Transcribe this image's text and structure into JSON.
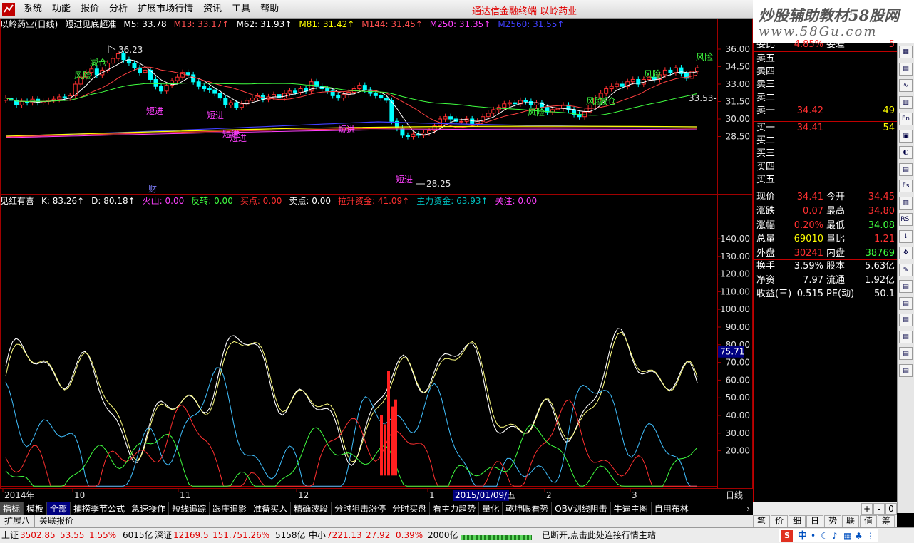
{
  "menu": {
    "items": [
      "系统",
      "功能",
      "报价",
      "分析",
      "扩展市场行情",
      "资讯",
      "工具",
      "帮助"
    ],
    "center_title": "通达信金融终端   以岭药业",
    "watermark_line1": "炒股辅助教材58股网",
    "watermark_line2": "www.58Gu.com"
  },
  "main_title": {
    "stock": "以岭药业(日线)",
    "indicator": "短进见底超准",
    "ma": [
      {
        "label": "M5: 33.78",
        "color": "#ffffff"
      },
      {
        "label": "M13: 33.17↑",
        "color": "#ff5050"
      },
      {
        "label": "M62: 31.93↑",
        "color": "#ffffff"
      },
      {
        "label": "M81: 31.42↑",
        "color": "#ffff00"
      },
      {
        "label": "M144: 31.45↑",
        "color": "#ff5050"
      },
      {
        "label": "M250: 31.35↑",
        "color": "#ff40ff"
      },
      {
        "label": "M2560: 31.55↑",
        "color": "#4040ff"
      }
    ]
  },
  "indicator_title": {
    "name": "见红有喜",
    "fields": [
      {
        "label": "K: 83.26↑",
        "color": "#ffffff"
      },
      {
        "label": "D: 80.18↑",
        "color": "#ffffff"
      },
      {
        "label": "火山: 0.00",
        "color": "#ff40ff"
      },
      {
        "label": "反转: 0.00",
        "color": "#40ff40"
      },
      {
        "label": "买点: 0.00",
        "color": "#ff3030"
      },
      {
        "label": "卖点: 0.00",
        "color": "#ffffff"
      },
      {
        "label": "拉升资金: 41.09↑",
        "color": "#ff3030"
      },
      {
        "label": "主力资金: 63.93↑",
        "color": "#00c0c0"
      },
      {
        "label": "关注: 0.00",
        "color": "#ff40ff"
      }
    ]
  },
  "price_axis": [
    "36.00",
    "34.50",
    "33.00",
    "31.50",
    "30.00",
    "28.50"
  ],
  "indicator_axis": [
    "140.00",
    "130.00",
    "120.00",
    "110.00",
    "100.00",
    "90.00",
    "80.00",
    "70.00",
    "60.00",
    "50.00",
    "40.00",
    "30.00",
    "20.00"
  ],
  "price_annotations": {
    "high": "36.23",
    "low": "28.25",
    "current": "33.53",
    "cursor_value": "75.71",
    "signals": [
      {
        "text": "风险",
        "color": "#40ff40"
      },
      {
        "text": "减仓",
        "color": "#40ff40"
      },
      {
        "text": "短进",
        "color": "#ff40ff"
      },
      {
        "text": "短进",
        "color": "#ff40ff"
      },
      {
        "text": "短进",
        "color": "#ff40ff"
      },
      {
        "text": "短进",
        "color": "#ff40ff"
      },
      {
        "text": "短进",
        "color": "#ff40ff"
      },
      {
        "text": "风险",
        "color": "#40ff40"
      },
      {
        "text": "风险",
        "color": "#40ff40"
      },
      {
        "text": "减仓",
        "color": "#40ff40"
      },
      {
        "text": "风险",
        "color": "#40ff40"
      },
      {
        "text": "风险",
        "color": "#40ff40"
      },
      {
        "text": "财",
        "color": "#8080ff"
      }
    ]
  },
  "date_axis": {
    "labels": [
      "2014年",
      "10",
      "11",
      "12",
      "1",
      "2",
      "3"
    ],
    "cursor_date": "2015/01/09/五",
    "period": "日线"
  },
  "tabs": [
    "指标",
    "模板",
    "全部",
    "捕捞季节公式",
    "急速操作",
    "短线追踪",
    "跟庄追影",
    "准备买入",
    "精确波段",
    "分时狙击涨停",
    "分时买盘",
    "看主力趋势",
    "量化",
    "乾坤眼看势",
    "OBV划线阻击",
    "牛逼主图",
    "自用布林"
  ],
  "tabs2": [
    "扩展八",
    "关联报价"
  ],
  "right_nav": [
    "+",
    "-",
    "0"
  ],
  "quote": {
    "header_label": "委比",
    "header_val": "4.85%",
    "header_label2": "委差",
    "header_val2": "5",
    "sell": [
      {
        "label": "卖五",
        "price": "",
        "vol": ""
      },
      {
        "label": "卖四",
        "price": "",
        "vol": ""
      },
      {
        "label": "卖三",
        "price": "",
        "vol": ""
      },
      {
        "label": "卖二",
        "price": "",
        "vol": ""
      },
      {
        "label": "卖一",
        "price": "34.42",
        "vol": "49"
      }
    ],
    "buy": [
      {
        "label": "买一",
        "price": "34.41",
        "vol": "54"
      },
      {
        "label": "买二",
        "price": "",
        "vol": ""
      },
      {
        "label": "买三",
        "price": "",
        "vol": ""
      },
      {
        "label": "买四",
        "price": "",
        "vol": ""
      },
      {
        "label": "买五",
        "price": "",
        "vol": ""
      }
    ],
    "stats": [
      {
        "l1": "现价",
        "v1": "34.41",
        "c1": "#ff3030",
        "l2": "今开",
        "v2": "34.45",
        "c2": "#ff3030"
      },
      {
        "l1": "涨跌",
        "v1": "0.07",
        "c1": "#ff3030",
        "l2": "最高",
        "v2": "34.80",
        "c2": "#ff3030"
      },
      {
        "l1": "涨幅",
        "v1": "0.20%",
        "c1": "#ff3030",
        "l2": "最低",
        "v2": "34.08",
        "c2": "#40ff40"
      },
      {
        "l1": "总量",
        "v1": "69010",
        "c1": "#ffff00",
        "l2": "量比",
        "v2": "1.21",
        "c2": "#ff3030"
      },
      {
        "l1": "外盘",
        "v1": "30241",
        "c1": "#ff3030",
        "l2": "内盘",
        "v2": "38769",
        "c2": "#40ff40"
      }
    ],
    "stats2": [
      {
        "l1": "换手",
        "v1": "3.59%",
        "l2": "股本",
        "v2": "5.63亿"
      },
      {
        "l1": "净资",
        "v1": "7.97",
        "l2": "流通",
        "v2": "1.92亿"
      },
      {
        "l1": "收益(三)",
        "v1": "0.515",
        "l2": "PE(动)",
        "v2": "50.1"
      }
    ]
  },
  "side_toolbar": [
    "▦",
    "▤",
    "∿",
    "▥",
    "Fn",
    "▣",
    "◐",
    "▤",
    "Fs",
    "▥",
    "RSI",
    "↓",
    "✥",
    "✎",
    "▤",
    "▤",
    "▤",
    "▤",
    "▤",
    "▤"
  ],
  "bottom_tabs": [
    "笔",
    "价",
    "细",
    "日",
    "势",
    "联",
    "值",
    "筹"
  ],
  "status": {
    "sh_label": "上证",
    "sh_val": "3502.85",
    "sh_chg": "53.55",
    "sh_pct": "1.55%",
    "sh_amt": "6015亿",
    "sz_label": "深证",
    "sz_val": "12169.5",
    "sz_chg": "151.75",
    "sz_pct": "1.26%",
    "sz_amt": "5158亿",
    "zx_label": "中小",
    "zx_val": "7221.13",
    "zx_chg": "27.92",
    "zx_pct": "0.39%",
    "zx_amt": "2000亿",
    "message": "已断开,点击此处连接行情主站",
    "ime": "中"
  }
}
